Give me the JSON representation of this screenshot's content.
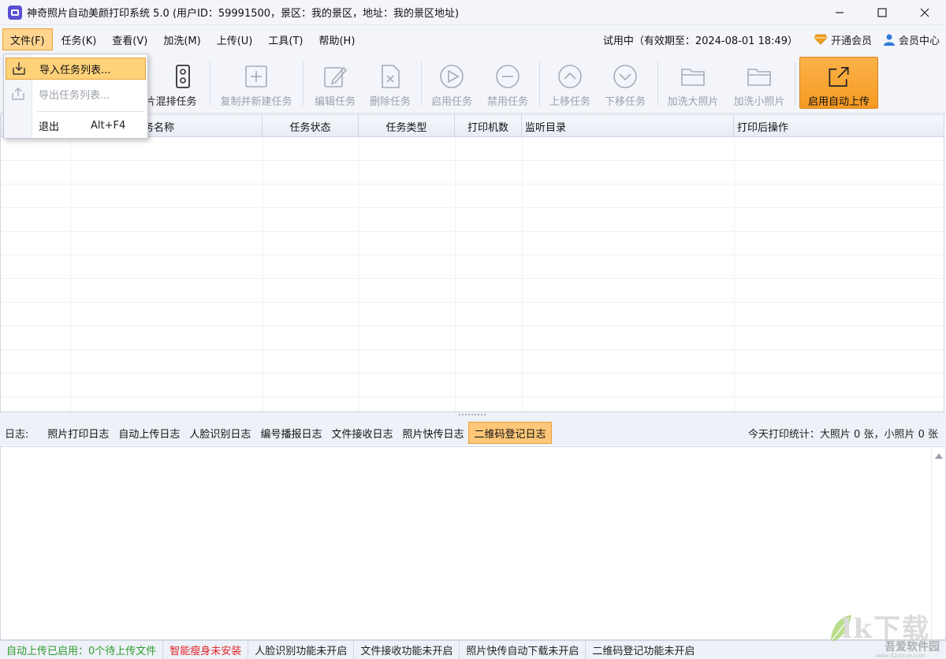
{
  "window": {
    "title": "神奇照片自动美颜打印系统 5.0 (用户ID：59991500，景区：我的景区，地址：我的景区地址)",
    "minimize_icon": "minimize-icon",
    "maximize_icon": "maximize-icon",
    "close_icon": "close-icon"
  },
  "menu": {
    "items": [
      "文件(F)",
      "任务(K)",
      "查看(V)",
      "加洗(M)",
      "上传(U)",
      "工具(T)",
      "帮助(H)"
    ],
    "active": "文件(F)",
    "trial_text": "试用中（有效期至：2024-08-01 18:49）",
    "vip_label": "开通会员",
    "member_center_label": "会员中心"
  },
  "file_menu": {
    "items": [
      {
        "label": "导入任务列表...",
        "icon": "import-icon",
        "highlighted": true
      },
      {
        "label": "导出任务列表...",
        "icon": "export-icon",
        "disabled": true
      },
      {
        "label": "退出",
        "shortcut": "Alt+F4"
      }
    ]
  },
  "toolbar": {
    "mixed_task_label": "片混排任务",
    "copy_new_label": "复制并新建任务",
    "edit_label": "编辑任务",
    "delete_label": "删除任务",
    "enable_label": "启用任务",
    "disable_label": "禁用任务",
    "up_label": "上移任务",
    "down_label": "下移任务",
    "reprint_large_label": "加洗大照片",
    "reprint_small_label": "加洗小照片",
    "auto_upload_label": "启用自动上传"
  },
  "table": {
    "columns": [
      "任务名称",
      "任务状态",
      "任务类型",
      "打印机数",
      "监听目录",
      "打印后操作"
    ],
    "rows": []
  },
  "log": {
    "label": "日志:",
    "tabs": [
      "照片打印日志",
      "自动上传日志",
      "人脸识别日志",
      "编号播报日志",
      "文件接收日志",
      "照片快传日志",
      "二维码登记日志"
    ],
    "active_tab": "二维码登记日志",
    "stats": "今天打印统计：大照片 0 张，小照片 0 张"
  },
  "status": {
    "auto_upload": "自动上传已启用：0个待上传文件",
    "slim": "智能瘦身未安装",
    "face": "人脸识别功能未开启",
    "file_receive": "文件接收功能未开启",
    "quick_download": "照片快传自动下载未开启",
    "qr": "二维码登记功能未开启"
  },
  "colors": {
    "accent": "#f59a22",
    "status_green": "#2e9b2e",
    "status_red": "#e0262a",
    "vip_gold": "#f0a020",
    "user_blue": "#2f7ad8"
  },
  "watermark": {
    "big": "lk下载",
    "small": "吾爱软件园",
    "url": "www.52zixue.com"
  }
}
